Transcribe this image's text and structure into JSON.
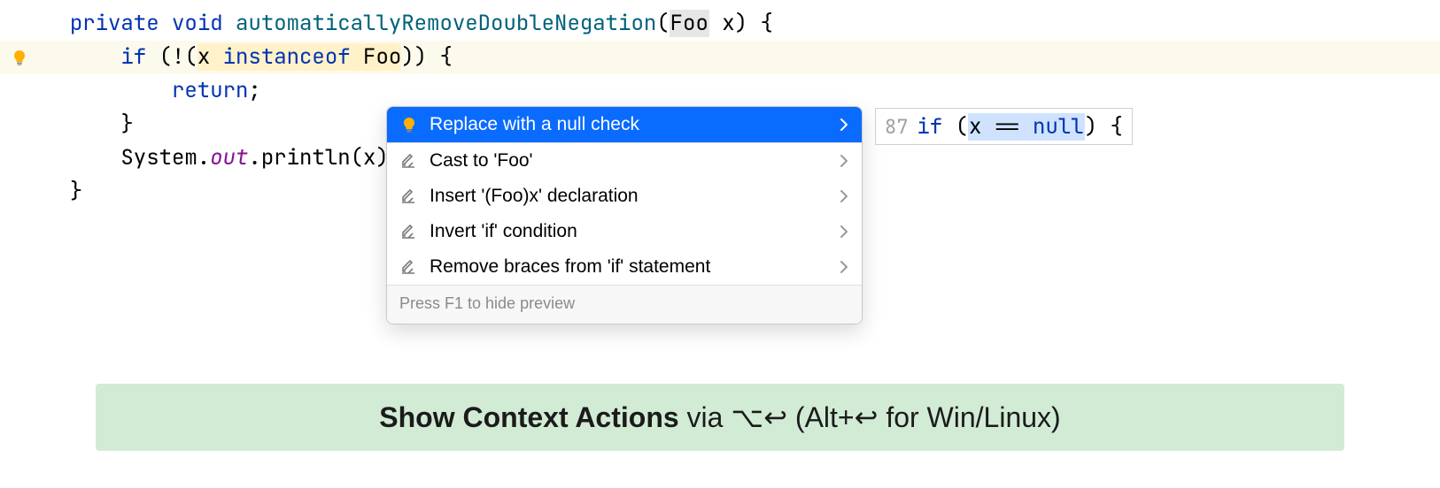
{
  "code": {
    "line1": {
      "kw_private": "private",
      "kw_void": "void",
      "method_name": "automaticallyRemoveDoubleNegation",
      "open_paren": "(",
      "param_type": "Foo",
      "param_name": "x",
      "close": ") {"
    },
    "line2": {
      "kw_if": "if",
      "open": " (!(",
      "var": "x",
      "kw_instanceof": " instanceof ",
      "type": "Foo",
      "close": ")) {"
    },
    "line3": {
      "kw_return": "return",
      "semi": ";"
    },
    "line4": {
      "brace": "}"
    },
    "line5": {
      "sys": "System.",
      "out": "out",
      "rest": ".println(x)"
    },
    "line6": {
      "brace": "}"
    }
  },
  "popup": {
    "items": [
      {
        "label": "Replace with a null check",
        "icon": "bulb",
        "selected": true
      },
      {
        "label": "Cast to 'Foo'",
        "icon": "pencil",
        "selected": false
      },
      {
        "label": "Insert '(Foo)x' declaration",
        "icon": "pencil",
        "selected": false
      },
      {
        "label": "Invert 'if' condition",
        "icon": "pencil",
        "selected": false
      },
      {
        "label": "Remove braces from 'if' statement",
        "icon": "pencil",
        "selected": false
      }
    ],
    "footer": "Press F1 to hide preview"
  },
  "preview": {
    "line_number": "87",
    "kw_if": "if",
    "open": " (",
    "expr_var": "x",
    "expr_op": " == ",
    "expr_null": "null",
    "close": ") {"
  },
  "banner": {
    "bold": "Show Context Actions",
    "via": " via ",
    "mac_key": "⌥↩",
    "paren_open": " (",
    "win_key": "Alt+↩",
    "for_text": " for Win/Linux",
    "paren_close": ")"
  }
}
